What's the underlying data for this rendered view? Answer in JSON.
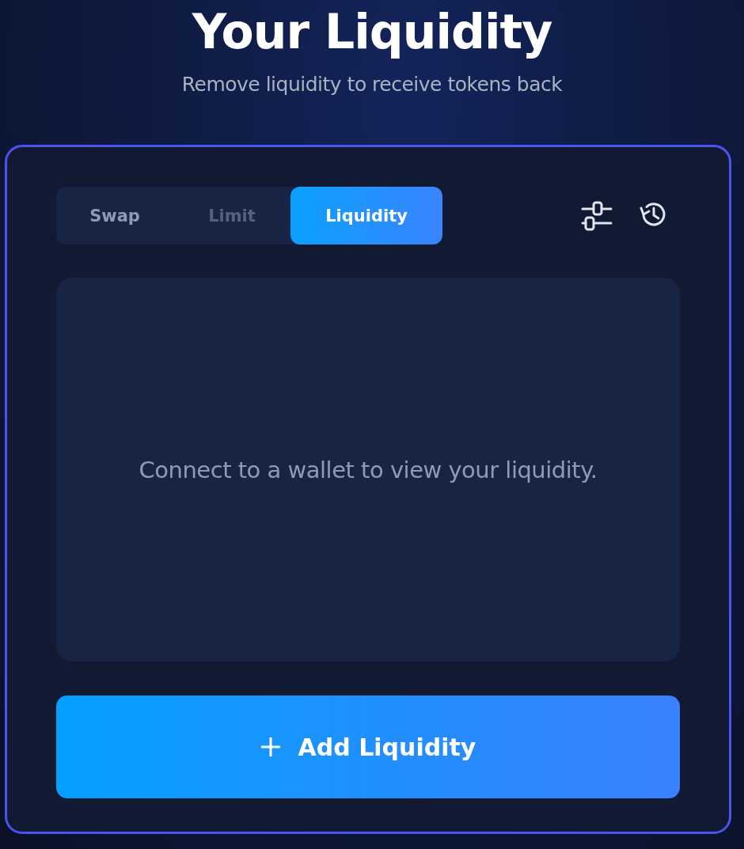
{
  "header": {
    "title": "Your Liquidity",
    "subtitle": "Remove liquidity to receive tokens back"
  },
  "tabs": [
    {
      "label": "Swap",
      "selected": false,
      "disabled": false
    },
    {
      "label": "Limit",
      "selected": false,
      "disabled": true
    },
    {
      "label": "Liquidity",
      "selected": true,
      "disabled": false
    }
  ],
  "empty_state": {
    "message": "Connect to a wallet to view your liquidity."
  },
  "primary_button": {
    "label": "Add Liquidity"
  }
}
